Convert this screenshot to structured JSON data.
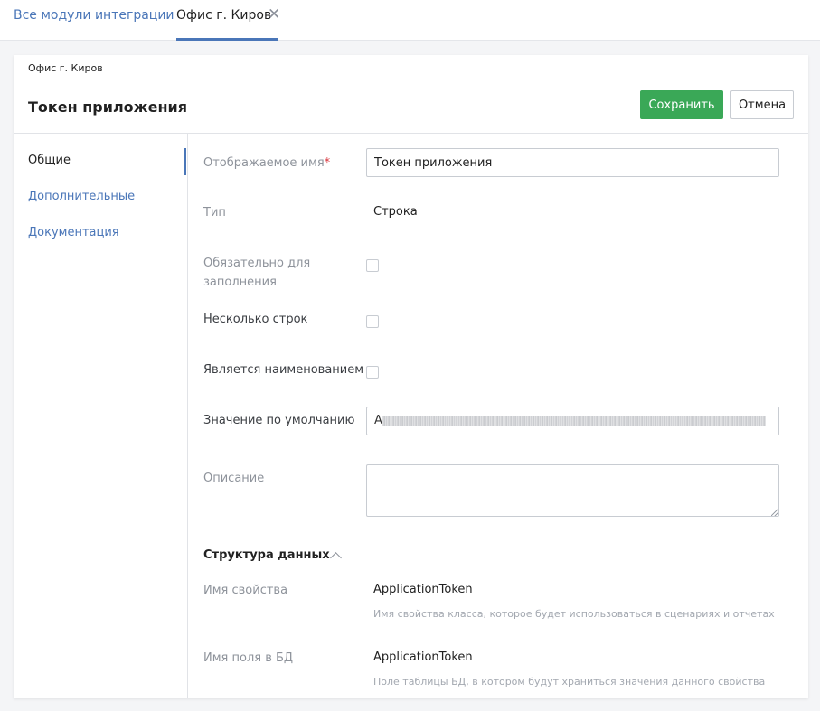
{
  "tabs": {
    "all_modules": "Все модули интеграции",
    "active": "Офис г. Киров",
    "close_glyph": "✕"
  },
  "card": {
    "breadcrumb": "Офис г. Киров",
    "title": "Токен приложения",
    "save_label": "Сохранить",
    "cancel_label": "Отмена"
  },
  "nav": [
    {
      "label": "Общие",
      "active": true
    },
    {
      "label": "Дополнительные",
      "active": false
    },
    {
      "label": "Документация",
      "active": false
    }
  ],
  "form": {
    "display_name_label": "Отображаемое имя",
    "required_mark": "*",
    "display_name_value": "Токен приложения",
    "type_label": "Тип",
    "type_value": "Строка",
    "required_label": "Обязательно для заполнения",
    "multiline_label": "Несколько строк",
    "is_name_label": "Является наименованием",
    "default_label": "Значение по умолчанию",
    "default_value_first_char": "A",
    "description_label": "Описание",
    "description_value": ""
  },
  "structure": {
    "title": "Структура данных",
    "property_name_label": "Имя свойства",
    "property_name_value": "ApplicationToken",
    "property_name_hint": "Имя свойства класса, которое будет использоваться в сценариях и отчетах",
    "db_field_label": "Имя поля в БД",
    "db_field_value": "ApplicationToken",
    "db_field_hint": "Поле таблицы БД, в котором будут храниться значения данного свойства"
  },
  "colors": {
    "accent": "#4a76b8",
    "save": "#3aa857",
    "required": "#d9363e"
  }
}
